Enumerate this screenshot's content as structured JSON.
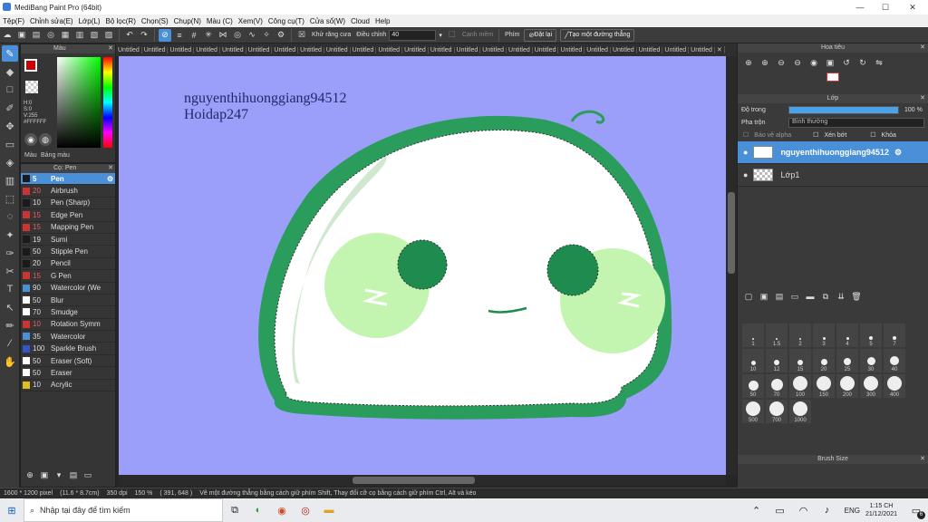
{
  "window": {
    "title": "MediBang Paint Pro (64bit)"
  },
  "menu": [
    "Tệp(F)",
    "Chỉnh sửa(E)",
    "Lớp(L)",
    "Bộ lọc(R)",
    "Chọn(S)",
    "Chụp(N)",
    "Màu (C)",
    "Xem(V)",
    "Công cụ(T)",
    "Cửa sổ(W)",
    "Cloud",
    "Help"
  ],
  "toolbar": {
    "antialias_label": "Khử răng cưa",
    "correction_label": "Điều chỉnh",
    "correction_value": "40",
    "soft_edge_label": "Cạnh mềm",
    "key_label": "Phím",
    "reset_label": "Đặt lại",
    "straight_line_label": "Tạo một đường thẳng"
  },
  "tabs": [
    "Untitled",
    "Untitled",
    "Untitled",
    "Untitled",
    "Untitled",
    "Untitled",
    "Untitled",
    "Untitled",
    "Untitled",
    "Untitled",
    "Untitled",
    "Untitled",
    "Untitled",
    "Untitled",
    "Untitled",
    "Untitled",
    "Untitled",
    "Untitled",
    "Untitled",
    "Untitled",
    "Untitled",
    "Untitled",
    "Untitled"
  ],
  "color_panel": {
    "title": "Màu",
    "h": "H:0",
    "s": "S:0",
    "v": "V:255",
    "hex": "#FFFFFF",
    "tab1": "Màu",
    "tab2": "Bảng màu",
    "fg_color": "#cc0000",
    "bg_color": "#ffffff"
  },
  "brush_panel": {
    "title": "Cọ: Pen",
    "brushes": [
      {
        "size": "5",
        "name": "Pen",
        "color": "#1a1a1a",
        "selected": true
      },
      {
        "size": "20",
        "name": "Airbrush",
        "color": "#cc3333"
      },
      {
        "size": "10",
        "name": "Pen (Sharp)",
        "color": "#1a1a1a"
      },
      {
        "size": "15",
        "name": "Edge Pen",
        "color": "#cc3333"
      },
      {
        "size": "15",
        "name": "Mapping Pen",
        "color": "#cc3333"
      },
      {
        "size": "19",
        "name": "Sumi",
        "color": "#1a1a1a"
      },
      {
        "size": "50",
        "name": "Stipple Pen",
        "color": "#1a1a1a"
      },
      {
        "size": "20",
        "name": "Pencil",
        "color": "#1a1a1a"
      },
      {
        "size": "15",
        "name": "G Pen",
        "color": "#cc3333"
      },
      {
        "size": "90",
        "name": "Watercolor (We",
        "color": "#4a90d9"
      },
      {
        "size": "50",
        "name": "Blur",
        "color": "#ffffff"
      },
      {
        "size": "70",
        "name": "Smudge",
        "color": "#ffffff"
      },
      {
        "size": "10",
        "name": "Rotation Symm",
        "color": "#cc3333"
      },
      {
        "size": "35",
        "name": "Watercolor",
        "color": "#4a90d9"
      },
      {
        "size": "100",
        "name": "Sparkle Brush",
        "color": "#3355cc"
      },
      {
        "size": "50",
        "name": "Eraser (Soft)",
        "color": "#ffffff"
      },
      {
        "size": "50",
        "name": "Eraser",
        "color": "#ffffff"
      },
      {
        "size": "10",
        "name": "Acrylic",
        "color": "#e0c020"
      }
    ]
  },
  "canvas": {
    "watermark_line1": "nguyenthihuonggiang94512",
    "watermark_line2": "Hoidap247",
    "background": "#9b9ff9"
  },
  "navigator": {
    "title": "Hoa tiêu"
  },
  "layer_panel": {
    "title": "Lớp",
    "opacity_label": "Độ trong",
    "opacity_value": "100 %",
    "opacity_fraction": 1.0,
    "blend_label": "Pha trộn",
    "blend_value": "Bình thường",
    "protect_alpha": "Bảo vệ alpha",
    "clipping": "Xén bớt",
    "lock": "Khóa",
    "layers": [
      {
        "name": "nguyenthihuonggiang94512",
        "selected": true
      },
      {
        "name": "Lớp1",
        "selected": false
      }
    ]
  },
  "brush_size": {
    "title": "Brush Size",
    "sizes": [
      "1",
      "1.5",
      "2",
      "3",
      "4",
      "5",
      "7",
      "10",
      "12",
      "15",
      "20",
      "25",
      "30",
      "40",
      "50",
      "70",
      "100",
      "150",
      "200",
      "300",
      "400",
      "500",
      "700",
      "1000"
    ]
  },
  "status": {
    "dimensions": "1600 * 1200 pixel",
    "physical": "(11.6 * 8.7cm)",
    "dpi": "350 dpi",
    "zoom": "150 %",
    "coords": "( 391, 648 )",
    "hint": "Vẽ một đường thẳng bằng cách giữ phím Shift, Thay đổi cỡ cọ bằng cách giữ phím Ctrl, Alt và kéo"
  },
  "taskbar": {
    "search_placeholder": "Nhập tại đây để tìm kiếm",
    "lang": "ENG",
    "time": "1:15 CH",
    "date": "21/12/2021",
    "notification_count": "6"
  }
}
